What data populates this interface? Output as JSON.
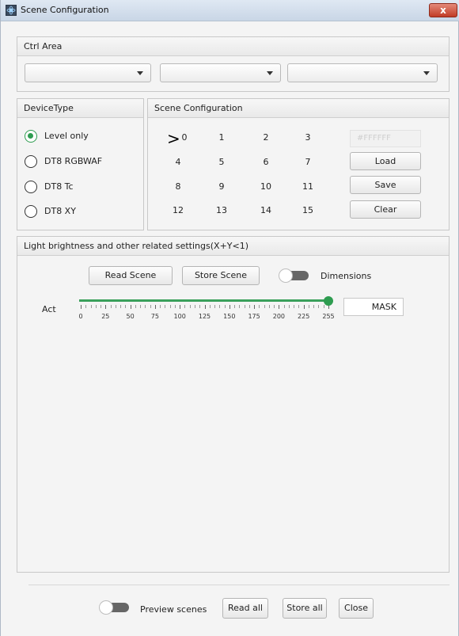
{
  "window": {
    "title": "Scene Configuration",
    "close_glyph": "x"
  },
  "ctrl_area": {
    "title": "Ctrl Area"
  },
  "device_type": {
    "title": "DeviceType",
    "options": [
      "Level only",
      "DT8 RGBWAF",
      "DT8 Tc",
      "DT8 XY"
    ],
    "selected": "Level only"
  },
  "scene_config": {
    "title": "Scene Configuration",
    "cursor_glyph": ">",
    "scenes": [
      "0",
      "1",
      "2",
      "3",
      "4",
      "5",
      "6",
      "7",
      "8",
      "9",
      "10",
      "11",
      "12",
      "13",
      "14",
      "15"
    ],
    "selected_scene": "0",
    "color_value": "#FFFFFF",
    "buttons": {
      "load": "Load",
      "save": "Save",
      "clear": "Clear"
    }
  },
  "brightness": {
    "title": "Light brightness and other related settings(X+Y<1)",
    "read_scene": "Read Scene",
    "store_scene": "Store Scene",
    "dimensions_label": "Dimensions",
    "act_label": "Act",
    "tick_labels": [
      "0",
      "25",
      "50",
      "75",
      "100",
      "125",
      "150",
      "175",
      "200",
      "225",
      "255"
    ],
    "slider_value": 255,
    "slider_max": 255,
    "mask_value": "MASK"
  },
  "footer": {
    "preview_label": "Preview scenes",
    "read_all": "Read all",
    "store_all": "Store all",
    "close": "Close"
  },
  "colors": {
    "accent": "#2e9c50",
    "close_button": "#c13c26"
  }
}
